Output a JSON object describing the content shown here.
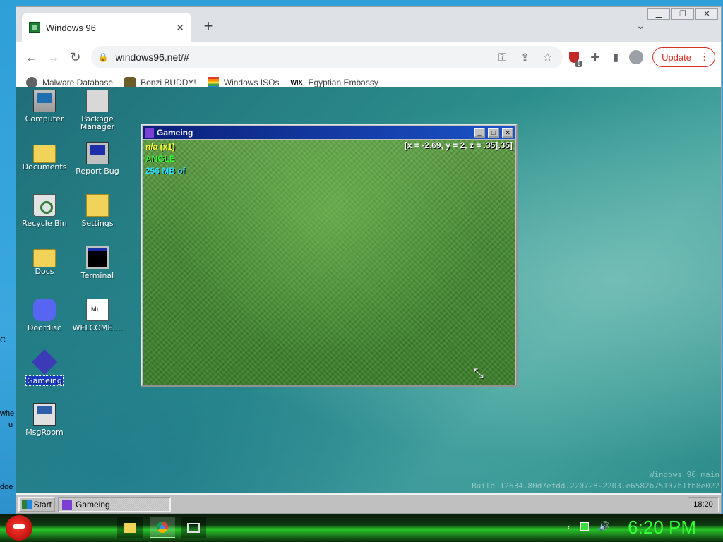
{
  "host": {
    "left_fragments": [
      "C",
      "whe",
      "u",
      "doe"
    ],
    "taskbar": {
      "clock": "6:20 PM"
    }
  },
  "browser": {
    "tab": {
      "title": "Windows 96"
    },
    "address": "windows96.net/#",
    "update_label": "Update",
    "extension_badge": "1",
    "bookmarks": [
      {
        "label": "Malware Database",
        "icon": "globe-icon"
      },
      {
        "label": "Bonzi BUDDY!",
        "icon": "bonzi-icon"
      },
      {
        "label": "Windows ISOs",
        "icon": "rainbow-icon"
      },
      {
        "label": "Egyptian Embassy",
        "icon": "wix-icon"
      }
    ]
  },
  "desktop": {
    "icons": [
      {
        "label": "Computer"
      },
      {
        "label": "Package Manager"
      },
      {
        "label": "Documents"
      },
      {
        "label": "Report Bug"
      },
      {
        "label": "Recycle Bin"
      },
      {
        "label": "Settings"
      },
      {
        "label": "Docs"
      },
      {
        "label": "Terminal"
      },
      {
        "label": "Doordisc"
      },
      {
        "label": "WELCOME...."
      },
      {
        "label": "Gameing"
      },
      {
        "label": "MsgRoom"
      }
    ],
    "watermark": {
      "line1": "Windows 96 main",
      "line2": "Build 12634.80d7efdd.220728-2203.e6582b75107b1fb8e022"
    }
  },
  "game_window": {
    "title": "Gameing",
    "hud": {
      "fps": "n/a (x1)",
      "renderer": "ANGLE",
      "memory": "256 MB of",
      "coords": "[x = -2.69, y = 2, z = .35].35]"
    }
  },
  "w96_taskbar": {
    "start_label": "Start",
    "task_label": "Gameing",
    "clock": "18:20"
  }
}
